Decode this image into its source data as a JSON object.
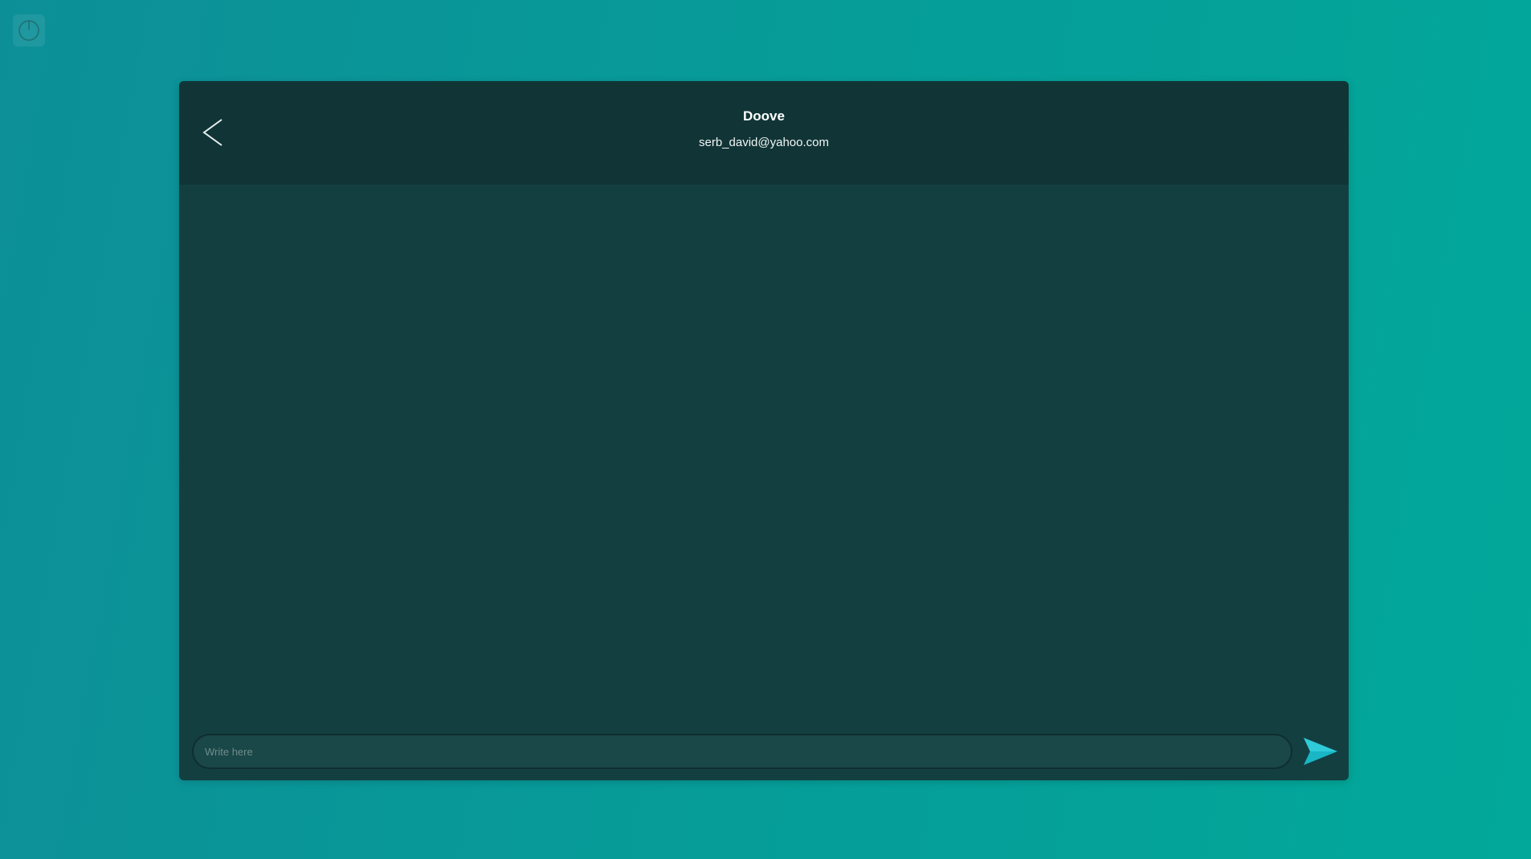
{
  "desktop": {
    "power_icon": "power-icon"
  },
  "chat": {
    "back_icon": "chevron-left-icon",
    "contact_name": "Doove",
    "contact_email": "serb_david@yahoo.com",
    "messages": [],
    "compose": {
      "placeholder": "Write here",
      "value": "",
      "send_icon": "send-icon"
    }
  },
  "colors": {
    "background_start": "#0d8f98",
    "background_end": "#02a89a",
    "window_bg": "#143f40",
    "header_bg": "#113536",
    "accent": "#19b6c6"
  }
}
